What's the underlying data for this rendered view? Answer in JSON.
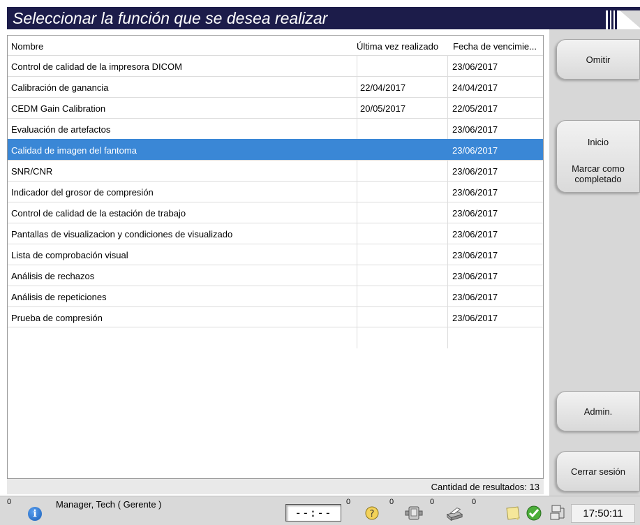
{
  "title": "Seleccionar la función que se desea realizar",
  "table": {
    "headers": [
      "Nombre",
      "Última vez realizado",
      "Fecha de vencimie..."
    ],
    "rows": [
      {
        "name": "Control de calidad de la impresora DICOM",
        "last": "",
        "due": "23/06/2017"
      },
      {
        "name": "Calibración de ganancia",
        "last": "22/04/2017",
        "due": "24/04/2017"
      },
      {
        "name": "CEDM Gain Calibration",
        "last": "20/05/2017",
        "due": "22/05/2017"
      },
      {
        "name": "Evaluación de artefactos",
        "last": "",
        "due": "23/06/2017"
      },
      {
        "name": "Calidad de imagen del fantoma",
        "last": "",
        "due": "23/06/2017"
      },
      {
        "name": "SNR/CNR",
        "last": "",
        "due": "23/06/2017"
      },
      {
        "name": "Indicador del grosor de compresión",
        "last": "",
        "due": "23/06/2017"
      },
      {
        "name": "Control de calidad de la estación de trabajo",
        "last": "",
        "due": "23/06/2017"
      },
      {
        "name": "Pantallas de visualizacion y condiciones de visualizado",
        "last": "",
        "due": "23/06/2017"
      },
      {
        "name": "Lista de comprobación visual",
        "last": "",
        "due": "23/06/2017"
      },
      {
        "name": "Análisis de rechazos",
        "last": "",
        "due": "23/06/2017"
      },
      {
        "name": "Análisis de repeticiones",
        "last": "",
        "due": "23/06/2017"
      },
      {
        "name": "Prueba de compresión",
        "last": "",
        "due": "23/06/2017"
      }
    ],
    "selected_index": 4
  },
  "result_count": "Cantidad de resultados: 13",
  "sidebar": {
    "skip": "Omitir",
    "start": "Inicio",
    "mark_complete": "Marcar como completado",
    "admin": "Admin.",
    "logout": "Cerrar sesión"
  },
  "statusbar": {
    "alert_count": "0",
    "user": "Manager, Tech ( Gerente )",
    "clock_display": "--:--",
    "count_a": "0",
    "count_b": "0",
    "count_c": "0",
    "count_d": "0",
    "time": "17:50:11"
  },
  "colors": {
    "title_band": "#1c1c4a",
    "selection": "#3a87d6",
    "sidebar": "#d7d7d7"
  },
  "icons": [
    "info-icon",
    "help-icon",
    "detector-icon",
    "printer-icon",
    "note-icon",
    "check-icon",
    "network-icon"
  ]
}
